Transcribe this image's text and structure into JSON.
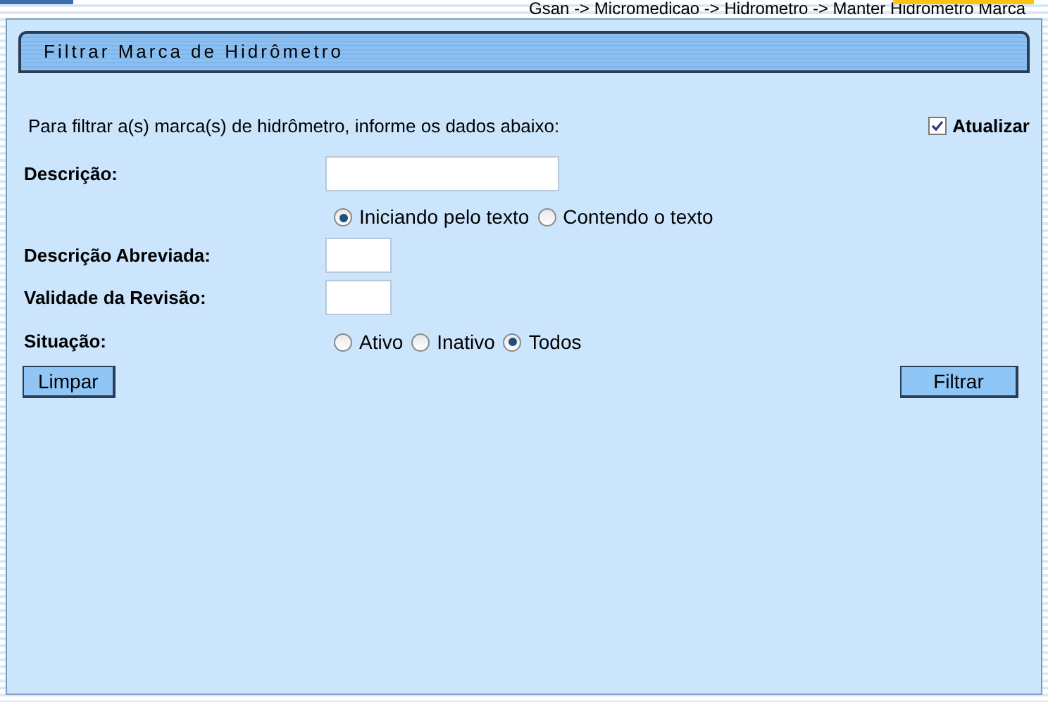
{
  "breadcrumb": "Gsan -> Micromedicao -> Hidrometro -> Manter Hidrometro Marca",
  "title": "Filtrar Marca de Hidrômetro",
  "intro": "Para filtrar a(s) marca(s) de hidrômetro, informe os dados abaixo:",
  "atualizar": {
    "label": "Atualizar",
    "checked": true
  },
  "fields": [
    {
      "kind": "wide-text",
      "label": "Descrição:"
    },
    {
      "kind": "radios",
      "options": [
        {
          "label": "Iniciando pelo texto",
          "selected": true
        },
        {
          "label": "Contendo o texto",
          "selected": false
        }
      ]
    },
    {
      "kind": "short-text",
      "label": "Descrição Abreviada:"
    },
    {
      "kind": "short-text",
      "label": "Validade da Revisão:"
    },
    {
      "kind": "radios",
      "label": "Situação:",
      "options": [
        {
          "label": "Ativo",
          "selected": false
        },
        {
          "label": "Inativo",
          "selected": false
        },
        {
          "label": "Todos",
          "selected": true
        }
      ]
    }
  ],
  "buttons": {
    "left": "Limpar",
    "right": "Filtrar"
  }
}
